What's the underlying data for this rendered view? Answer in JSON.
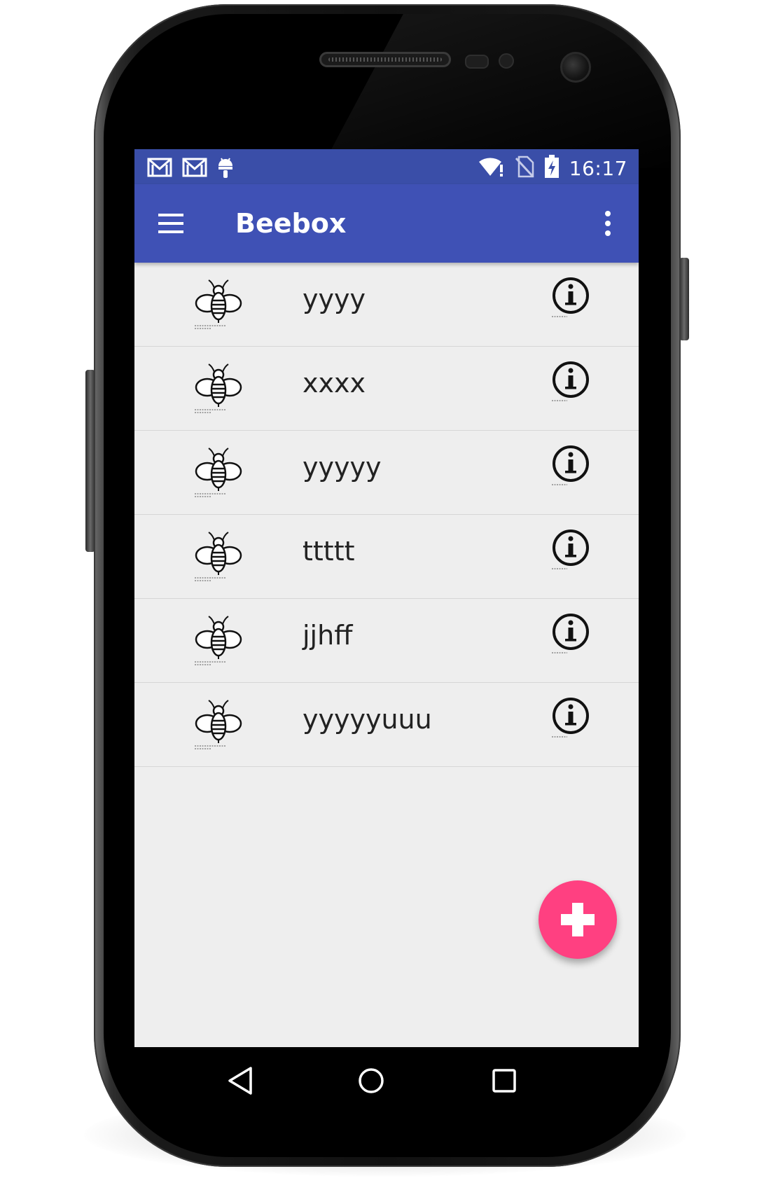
{
  "status_bar": {
    "time": "16:17",
    "left_icons": [
      "gmail-icon",
      "gmail-icon",
      "android-debug-icon"
    ],
    "right_icons": [
      "wifi-alert-icon",
      "no-sim-icon",
      "battery-charging-icon"
    ],
    "color": "#3a4ea8"
  },
  "app_bar": {
    "title": "Beebox",
    "color": "#3f51b5",
    "menu_icon": "hamburger-menu-icon",
    "overflow_icon": "overflow-menu-icon"
  },
  "list": {
    "items": [
      {
        "label": "yyyy",
        "icon": "bee-icon",
        "action_icon": "info-icon"
      },
      {
        "label": "xxxx",
        "icon": "bee-icon",
        "action_icon": "info-icon"
      },
      {
        "label": "yyyyy",
        "icon": "bee-icon",
        "action_icon": "info-icon"
      },
      {
        "label": "ttttt",
        "icon": "bee-icon",
        "action_icon": "info-icon"
      },
      {
        "label": "jjhff",
        "icon": "bee-icon",
        "action_icon": "info-icon"
      },
      {
        "label": "yyyyyuuu",
        "icon": "bee-icon",
        "action_icon": "info-icon"
      }
    ]
  },
  "fab": {
    "icon": "plus-icon",
    "color": "#ff4081"
  },
  "nav_bar": {
    "buttons": [
      "back-icon",
      "home-icon",
      "recents-icon"
    ]
  }
}
